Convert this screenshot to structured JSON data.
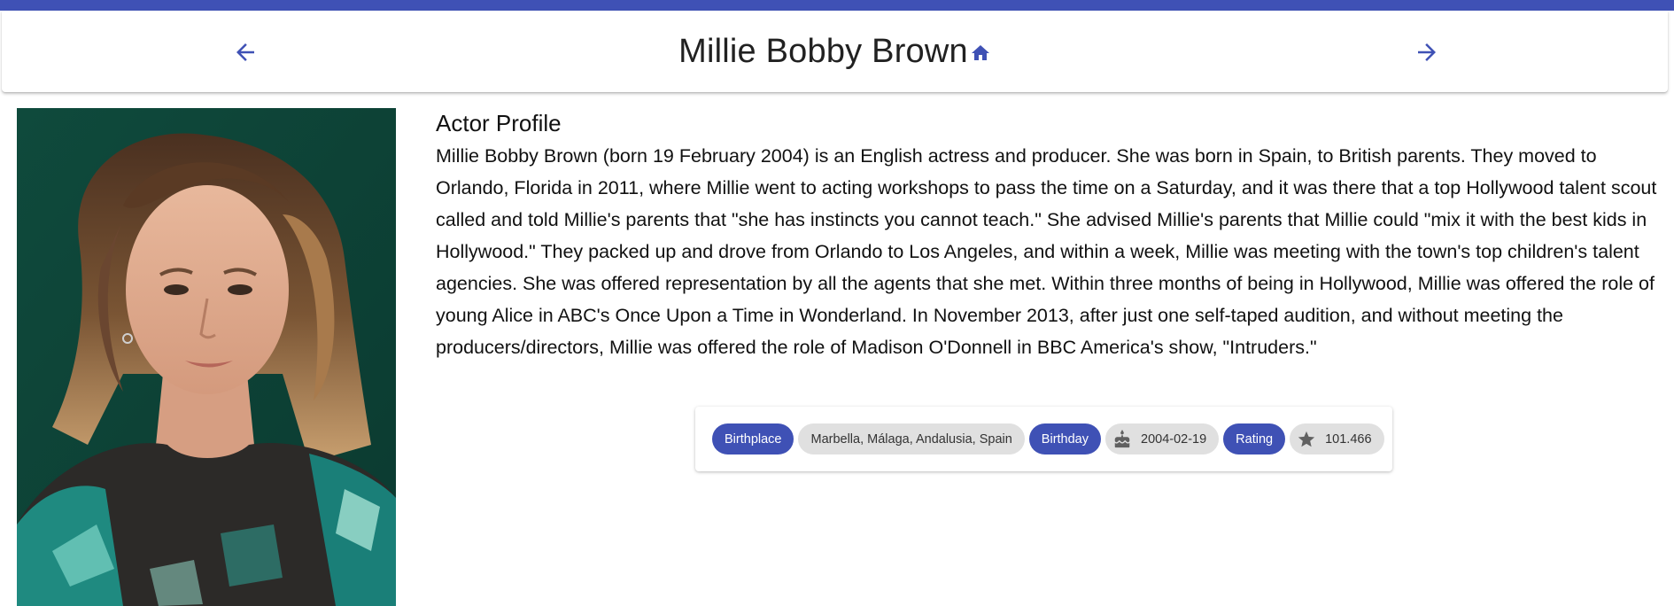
{
  "colors": {
    "accent": "#3f51b5",
    "chip_neutral": "#e0e0e0",
    "icon_gray": "#616161"
  },
  "header": {
    "title": "Millie Bobby Brown",
    "back_icon": "arrow-left-icon",
    "home_icon": "home-icon",
    "forward_icon": "arrow-right-icon"
  },
  "profile": {
    "section_title": "Actor Profile",
    "bio": "Millie Bobby Brown (born 19 February 2004) is an English actress and producer. She was born in Spain, to British parents. They moved to Orlando, Florida in 2011, where Millie went to acting workshops to pass the time on a Saturday, and it was there that a top Hollywood talent scout called and told Millie's parents that \"she has instincts you cannot teach.\" She advised Millie's parents that Millie could \"mix it with the best kids in Hollywood.\" They packed up and drove from Orlando to Los Angeles, and within a week, Millie was meeting with the town's top children's talent agencies. She was offered representation by all the agents that she met. Within three months of being in Hollywood, Millie was offered the role of young Alice in ABC's Once Upon a Time in Wonderland. In November 2013, after just one self-taped audition, and without meeting the producers/directors, Millie was offered the role of Madison O'Donnell in BBC America's show, \"Intruders.\""
  },
  "details": {
    "birthplace_label": "Birthplace",
    "birthplace_value": "Marbella, Málaga, Andalusia, Spain",
    "birthday_label": "Birthday",
    "birthday_value": "2004-02-19",
    "birthday_icon": "cake-icon",
    "rating_label": "Rating",
    "rating_value": "101.466",
    "rating_icon": "star-icon"
  }
}
